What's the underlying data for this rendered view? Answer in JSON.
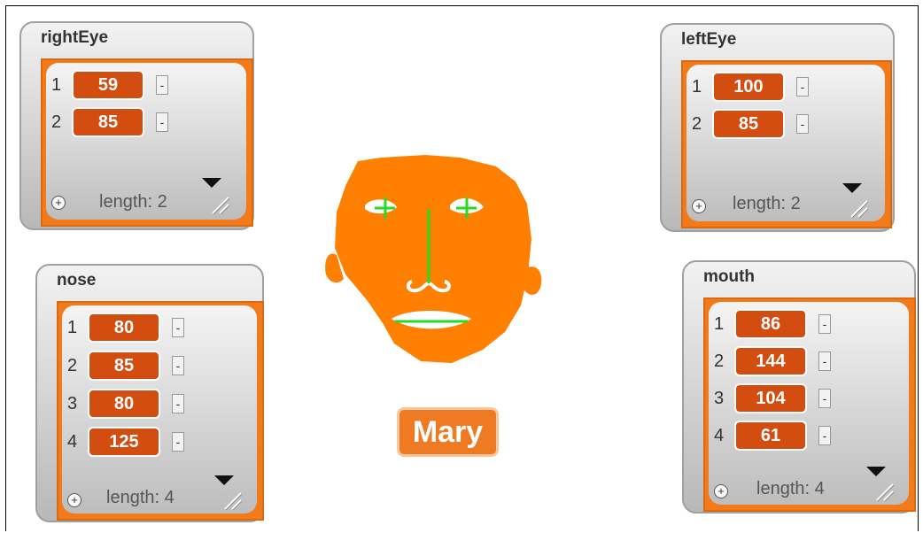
{
  "watchers": {
    "rightEye": {
      "title": "rightEye",
      "items": [
        "59",
        "85"
      ],
      "length_label": "length: 2"
    },
    "leftEye": {
      "title": "leftEye",
      "items": [
        "100",
        "85"
      ],
      "length_label": "length: 2"
    },
    "nose": {
      "title": "nose",
      "items": [
        "80",
        "85",
        "80",
        "125"
      ],
      "length_label": "length: 4"
    },
    "mouth": {
      "title": "mouth",
      "items": [
        "86",
        "144",
        "104",
        "61"
      ],
      "length_label": "length: 4"
    }
  },
  "indices": [
    "1",
    "2",
    "3",
    "4"
  ],
  "ui": {
    "minus": "-",
    "plus": "+"
  },
  "sprite_label": "Mary",
  "colors": {
    "orange": "#ff8000",
    "cell": "#d34d11",
    "green": "#22dd22",
    "list_border": "#f27a1a"
  }
}
